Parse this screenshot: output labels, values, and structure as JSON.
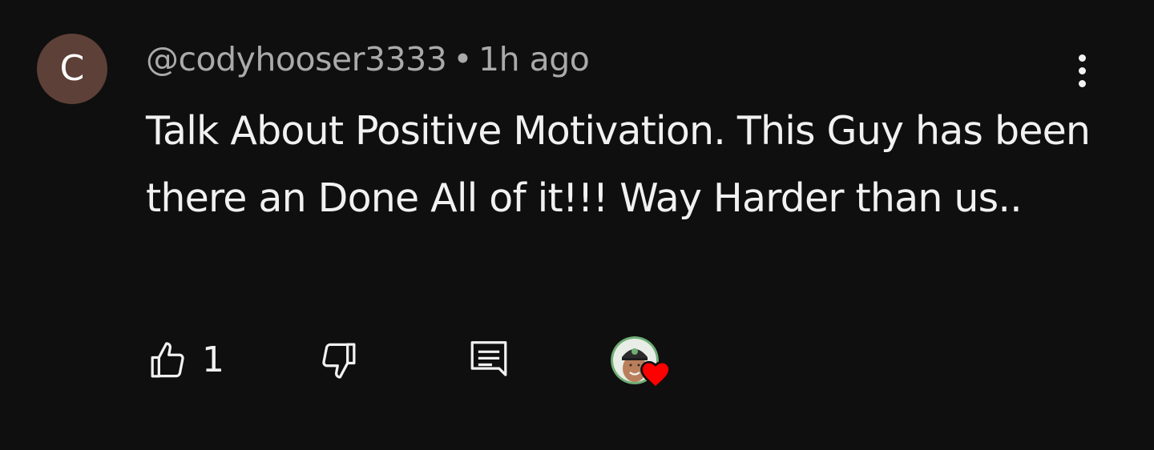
{
  "comment": {
    "avatar_letter": "C",
    "avatar_color": "#5d4037",
    "author": "@codyhooser3333",
    "separator": "•",
    "timestamp": "1h ago",
    "text": "Talk About Positive Motivation. This Guy has been there an Done All of it!!! Way Harder than us..",
    "like_count": "1"
  },
  "icons": {
    "more": "vertical-dots-icon",
    "like": "thumbs-up-icon",
    "dislike": "thumbs-down-icon",
    "reply": "comment-reply-icon",
    "heart": "heart-icon"
  },
  "colors": {
    "background": "#0f0f0f",
    "heart": "#ff0000",
    "meta_text": "#aaaaaa",
    "body_text": "#f1f1f1"
  }
}
